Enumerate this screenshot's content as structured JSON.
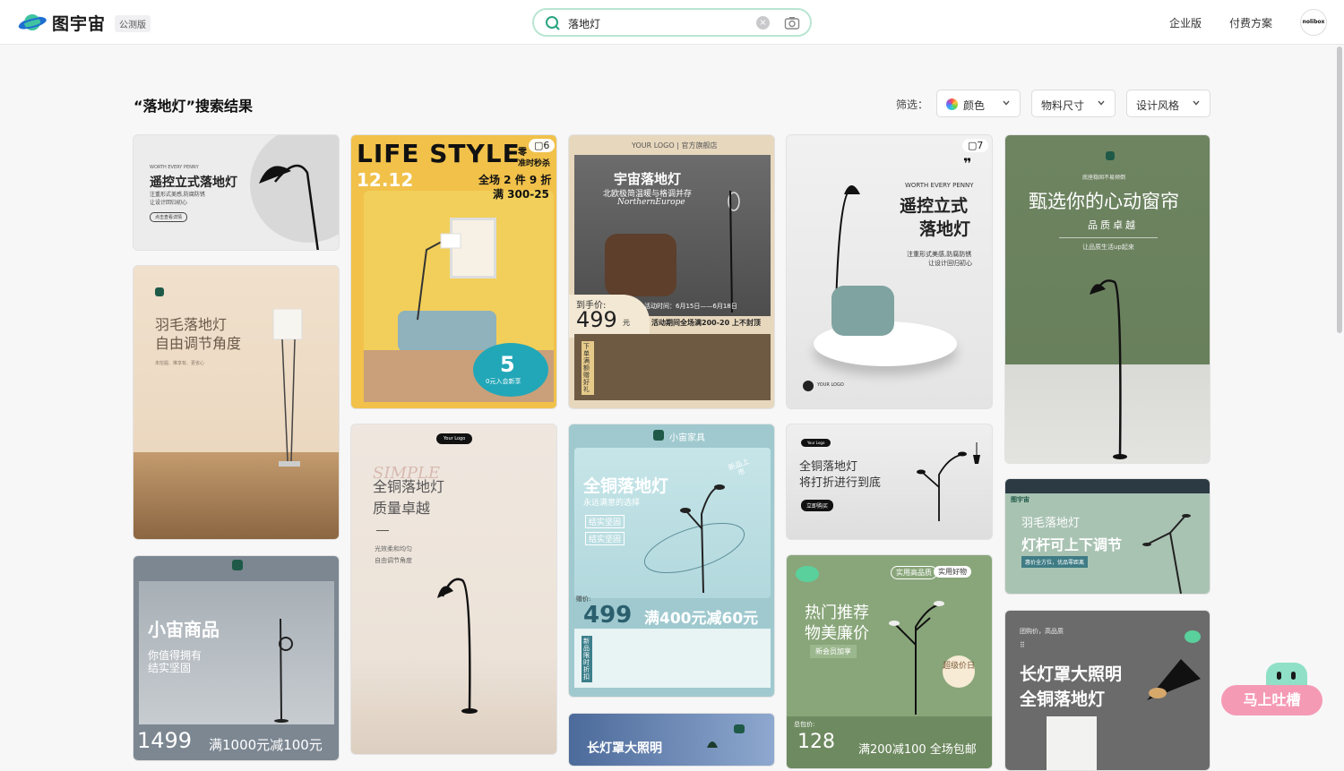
{
  "header": {
    "brand": "图宇宙",
    "beta": "公测版",
    "search_value": "落地灯",
    "nav": [
      "企业版",
      "付费方案"
    ],
    "avatar": "nolibox"
  },
  "results": {
    "title": "“落地灯”搜索结果",
    "filter_label": "筛选：",
    "filters": [
      "颜色",
      "物料尺寸",
      "设计风格"
    ]
  },
  "cards": {
    "c1": {
      "small": "WORTH EVERY PENNY",
      "title": "遥控立式落地灯",
      "sub1": "注重形式美感,防腐防锈",
      "sub2": "让设计回归初心",
      "btn": "点击查看详情"
    },
    "c2": {
      "title1": "羽毛落地灯",
      "title2": "自由调节角度",
      "sub": "未挖掘、推享有、更省心"
    },
    "c3": {
      "title": "小宙商品",
      "sub1": "你值得拥有",
      "sub2": "结实坚固",
      "price": "1499",
      "offer": "满1000元减100元"
    },
    "c4": {
      "title": "LIFE STYLE",
      "date": "12.12",
      "t1": "零",
      "t2": "准时秒杀",
      "line1": "全场 2 件 9 折",
      "line2": "满 300-25",
      "big": "5",
      "coupon": "0元入会新享",
      "count": "6"
    },
    "c5": {
      "logo": "Your Logo",
      "script": "SIMPLE",
      "title1": "全铜落地灯",
      "title2": "质量卓越",
      "sub1": "光效柔和均匀",
      "sub2": "自由调节角度"
    },
    "c6": {
      "store": "YOUR LOGO | 官方旗舰店",
      "title": "宇宙落地灯",
      "sub": "北欧极简温暖与格调并存",
      "en": "NorthernEurope",
      "price_label": "到手价:",
      "price": "499",
      "unit": "元",
      "promo1": "活动时间：6月15日——6月18日",
      "promo2": "活动期间全场满200-20 上不封顶",
      "side": "下单满额赠好礼"
    },
    "c7": {
      "brand": "小宙家具",
      "title": "全铜落地灯",
      "sub": "永远满意的选择",
      "tag1": "结实坚固",
      "tag2": "结实坚固",
      "badge": "新品上市",
      "price_label": "赠价:",
      "price": "499",
      "offer": "满400元减60元",
      "side": "新品限时折扣"
    },
    "c8": {
      "title": "长灯罩大照明"
    },
    "c9": {
      "small": "WORTH EVERY PENNY",
      "title1": "遥控立式",
      "title2": "落地灯",
      "sub1": "注重形式美感,防腐防锈",
      "sub2": "让设计回归初心",
      "logo": "YOUR LOGO",
      "count": "7"
    },
    "c10": {
      "logo": "Your Logo",
      "title1": "全铜落地灯",
      "title2": "将打折进行到底",
      "btn": "立即购买"
    },
    "c11": {
      "tab1": "实用高品质",
      "tab2": "实用好物",
      "title1": "热门推荐",
      "title2": "物美廉价",
      "sub": "新会员加享",
      "seal": "超级价日",
      "price_label": "总包价:",
      "price": "128",
      "offer": "满200减100 全场包邮"
    },
    "c12": {
      "top": "底座稳固不易倾倒",
      "title": "甄选你的心动窗帘",
      "sub": "品质卓越",
      "small": "让品质生活up起来"
    },
    "c13": {
      "brand": "图宇宙",
      "title1": "羽毛落地灯",
      "title2": "灯杆可上下调节",
      "tag": "惠价全方位，优品零距离"
    },
    "c14": {
      "small": "团购价，高品质",
      "title1": "长灯罩大照明",
      "title2": "全铜落地灯"
    }
  },
  "feedback": {
    "label": "马上吐槽"
  }
}
